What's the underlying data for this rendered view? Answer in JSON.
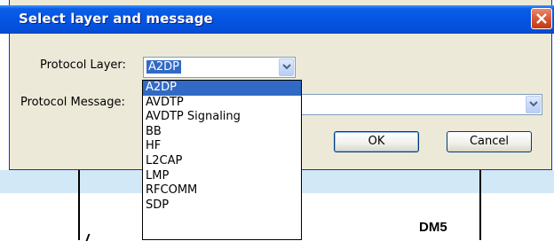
{
  "window": {
    "title": "Select layer and message"
  },
  "background": {
    "label": "DM5"
  },
  "form": {
    "protocol_layer_label": "Protocol Layer:",
    "protocol_layer_value": "A2DP",
    "protocol_message_label": "Protocol Message:",
    "protocol_message_value": ""
  },
  "buttons": {
    "ok": "OK",
    "cancel": "Cancel"
  },
  "dropdown_list": {
    "items": [
      "A2DP",
      "AVDTP",
      "AVDTP Signaling",
      "BB",
      "HF",
      "L2CAP",
      "LMP",
      "RFCOMM",
      "SDP"
    ],
    "selected": "A2DP"
  },
  "colors": {
    "titlebar": "#0554e3",
    "selection": "#316ac5",
    "dialog_face": "#ece9d8",
    "close": "#d94e2a"
  }
}
